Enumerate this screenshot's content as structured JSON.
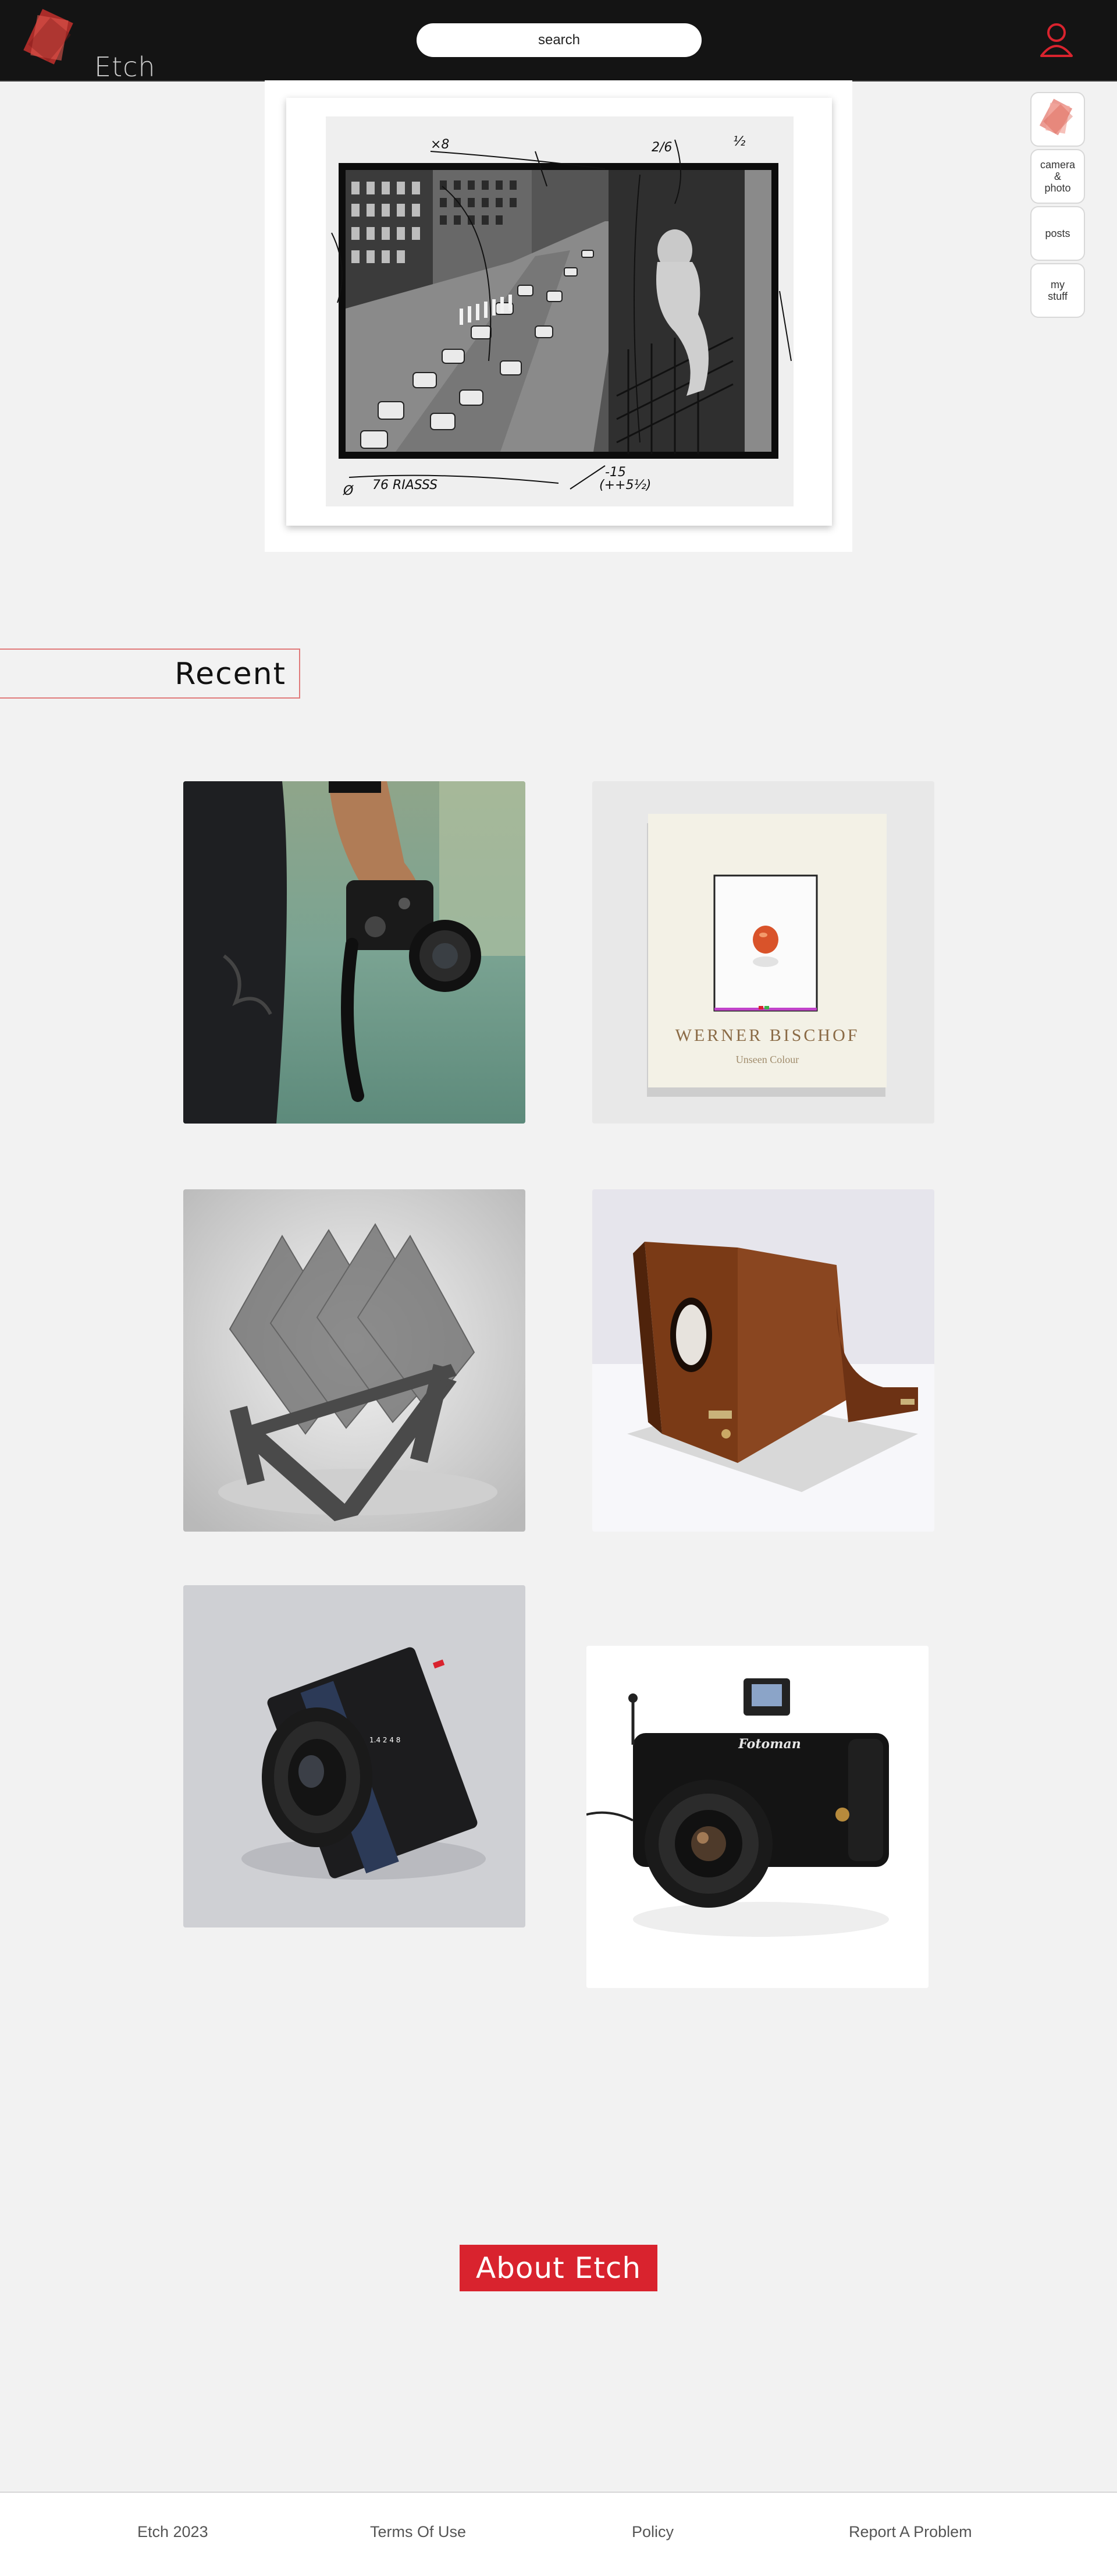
{
  "header": {
    "logo_text": "Etch",
    "search_placeholder": "search"
  },
  "side_nav": {
    "items": [
      {
        "label": ""
      },
      {
        "label": "camera\n&\nphoto"
      },
      {
        "label": "posts"
      },
      {
        "label": "my\nstuff"
      }
    ]
  },
  "recent": {
    "title": "Recent"
  },
  "featured_book": {
    "title": "WERNER BISCHOF",
    "subtitle": "Unseen Colour"
  },
  "fotoman_label": "Fotoman",
  "about": {
    "button_label": "About Etch"
  },
  "footer": {
    "copyright": "Etch 2023",
    "terms": "Terms Of Use",
    "policy": "Policy",
    "report": "Report A Problem"
  },
  "colors": {
    "accent": "#d9232e",
    "header_bg": "#141414",
    "page_bg": "#f2f2f2"
  }
}
